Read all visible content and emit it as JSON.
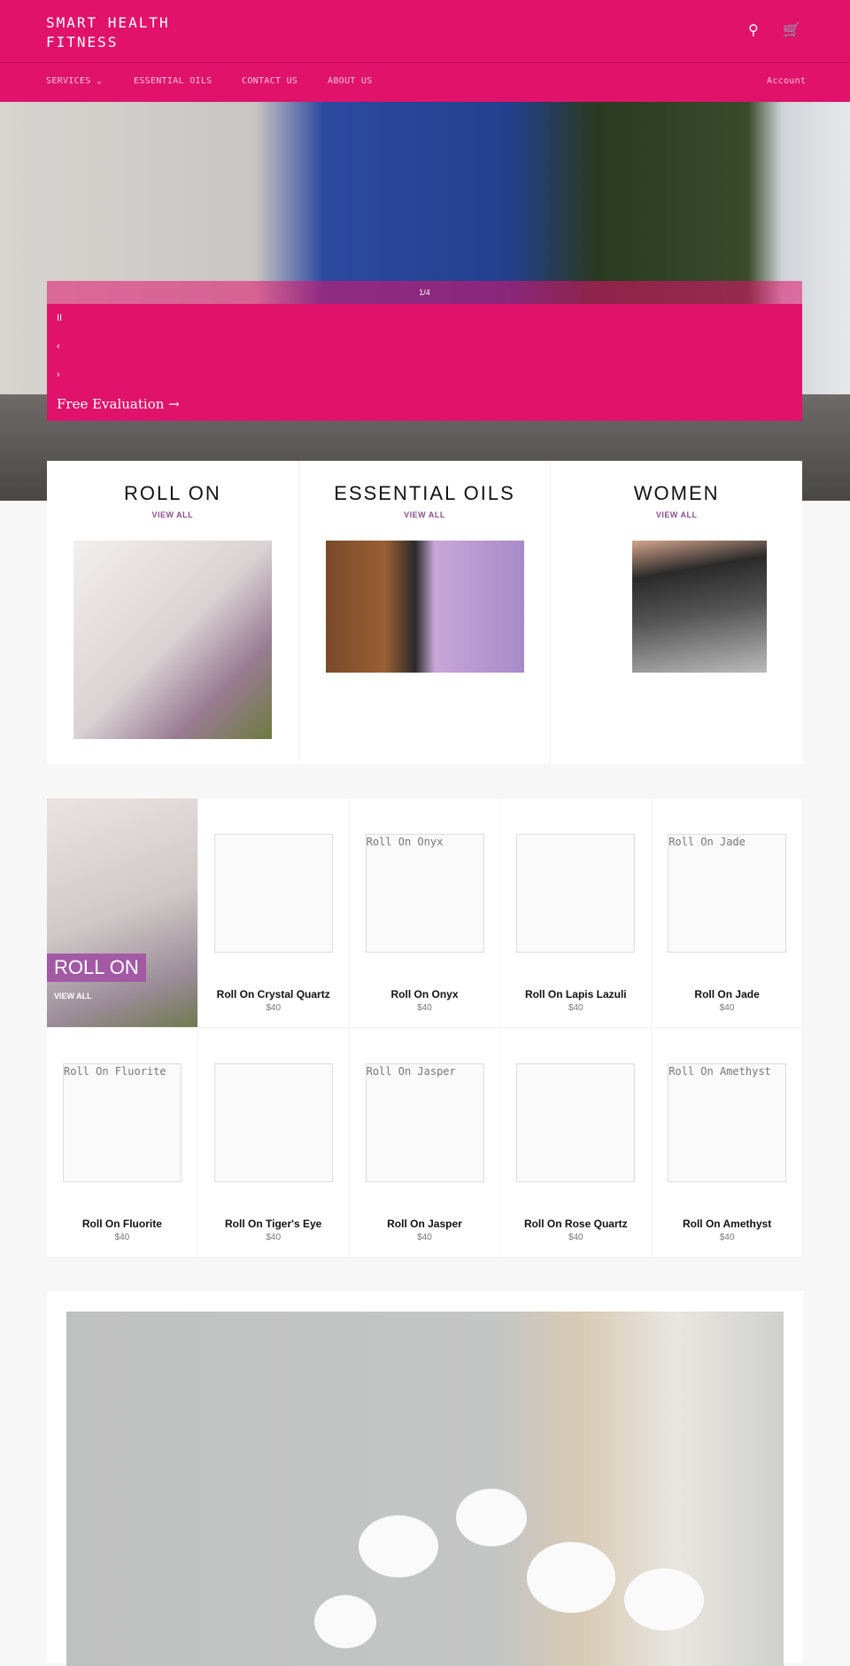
{
  "header": {
    "logo": "SMART HEALTH FITNESS",
    "icons": [
      "search-icon",
      "cart-icon"
    ]
  },
  "nav": {
    "items": [
      "SERVICES ⌄",
      "ESSENTIAL OILS",
      "CONTACT US",
      "ABOUT US"
    ],
    "account": "Account"
  },
  "hero": {
    "counter": "1/4",
    "pause": "II",
    "prev": "‹",
    "next": "›",
    "cta": "Free Evaluation →"
  },
  "collections": [
    {
      "title": "ROLL ON",
      "link": "VIEW ALL"
    },
    {
      "title": "ESSENTIAL OILS",
      "link": "VIEW ALL"
    },
    {
      "title": "WOMEN",
      "link": "VIEW ALL"
    }
  ],
  "featured": {
    "title": "ROLL ON",
    "link": "VIEW ALL"
  },
  "products": [
    {
      "name": "Roll On Crystal Quartz",
      "price": "$40",
      "alt": ""
    },
    {
      "name": "Roll On Onyx",
      "price": "$40",
      "alt": "Roll On Onyx"
    },
    {
      "name": "Roll On Lapis Lazuli",
      "price": "$40",
      "alt": ""
    },
    {
      "name": "Roll On Jade",
      "price": "$40",
      "alt": "Roll On Jade"
    },
    {
      "name": "Roll On Fluorite",
      "price": "$40",
      "alt": "Roll On Fluorite"
    },
    {
      "name": "Roll On Tiger's Eye",
      "price": "$40",
      "alt": ""
    },
    {
      "name": "Roll On Jasper",
      "price": "$40",
      "alt": "Roll On Jasper"
    },
    {
      "name": "Roll On Rose Quartz",
      "price": "$40",
      "alt": ""
    },
    {
      "name": "Roll On Amethyst",
      "price": "$40",
      "alt": "Roll On Amethyst"
    }
  ],
  "colors": {
    "brand": "#e0126b",
    "accent": "#a25aa5"
  }
}
